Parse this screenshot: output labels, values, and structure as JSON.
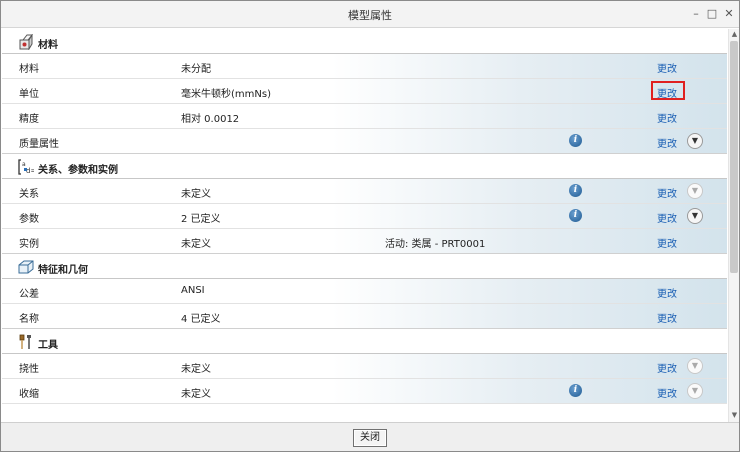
{
  "window": {
    "title": "模型属性",
    "controls": [
      "minimize-icon",
      "maximize-icon",
      "close-icon"
    ]
  },
  "sections": {
    "materials": {
      "title": "材料",
      "icon": "material-icon",
      "rows": [
        {
          "label": "材料",
          "value": "未分配",
          "change": "更改"
        },
        {
          "label": "单位",
          "value": "毫米牛顿秒(mmNs)",
          "change": "更改"
        },
        {
          "label": "精度",
          "value": "相对 0.0012",
          "change": "更改"
        },
        {
          "label": "质量属性",
          "value": "",
          "change": "更改"
        }
      ]
    },
    "relations": {
      "title": "关系、参数和实例",
      "icon": "relations-icon",
      "rows": [
        {
          "label": "关系",
          "value": "未定义",
          "change": "更改"
        },
        {
          "label": "参数",
          "value": "2 已定义",
          "change": "更改"
        },
        {
          "label": "实例",
          "value": "未定义",
          "extra": "活动: 类属 - PRT0001",
          "change": "更改"
        }
      ]
    },
    "features": {
      "title": "特征和几何",
      "icon": "features-icon",
      "rows": [
        {
          "label": "公差",
          "value": "ANSI",
          "change": "更改"
        },
        {
          "label": "名称",
          "value": "4 已定义",
          "change": "更改"
        }
      ]
    },
    "tools": {
      "title": "工具",
      "icon": "tools-icon",
      "rows": [
        {
          "label": "挠性",
          "value": "未定义",
          "change": "更改"
        },
        {
          "label": "收缩",
          "value": "未定义",
          "change": "更改"
        }
      ]
    }
  },
  "footer": {
    "close_label": "关闭"
  },
  "colors": {
    "link": "#1a5fb4",
    "highlight_border": "#e02020",
    "row_gradient_end": "#d3e3ec"
  }
}
